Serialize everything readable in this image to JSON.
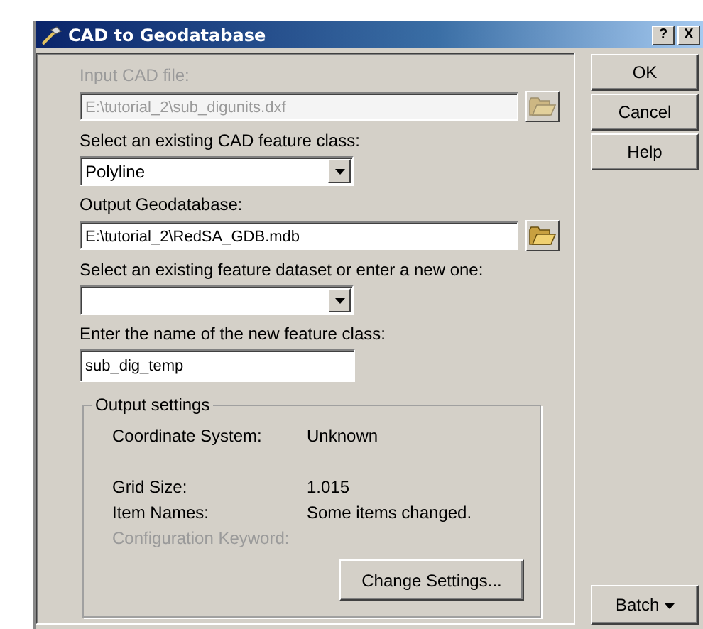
{
  "window": {
    "title": "CAD to Geodatabase",
    "title_buttons": [
      "?",
      "X"
    ]
  },
  "fields": [
    {
      "kind": "file",
      "label": "Input CAD file:",
      "value": "E:\\tutorial_2\\sub_digunits.dxf",
      "disabled": true
    },
    {
      "kind": "combo",
      "label": "Select an existing CAD feature class:",
      "value": "Polyline",
      "disabled": false
    },
    {
      "kind": "file",
      "label": "Output Geodatabase:",
      "value": "E:\\tutorial_2\\RedSA_GDB.mdb",
      "disabled": false
    },
    {
      "kind": "combo",
      "label": "Select an existing feature dataset or enter a new one:",
      "disabled": false
    },
    {
      "kind": "text",
      "label": "Enter the name of the new feature class:",
      "value": "sub_dig_temp",
      "disabled": false
    }
  ],
  "output_settings": {
    "title": "Output settings",
    "rows": [
      {
        "label": "Coordinate System:",
        "value": "Unknown",
        "disabled": false
      },
      {
        "label": "Grid Size:",
        "value": "1.015",
        "disabled": false
      },
      {
        "label": "Item Names:",
        "value": "Some items changed.",
        "disabled": false
      },
      {
        "label": "Configuration Keyword:",
        "disabled": true
      }
    ],
    "button": "Change Settings..."
  },
  "buttons": [
    "OK",
    "Cancel",
    "Help"
  ],
  "batch_button": "Batch"
}
